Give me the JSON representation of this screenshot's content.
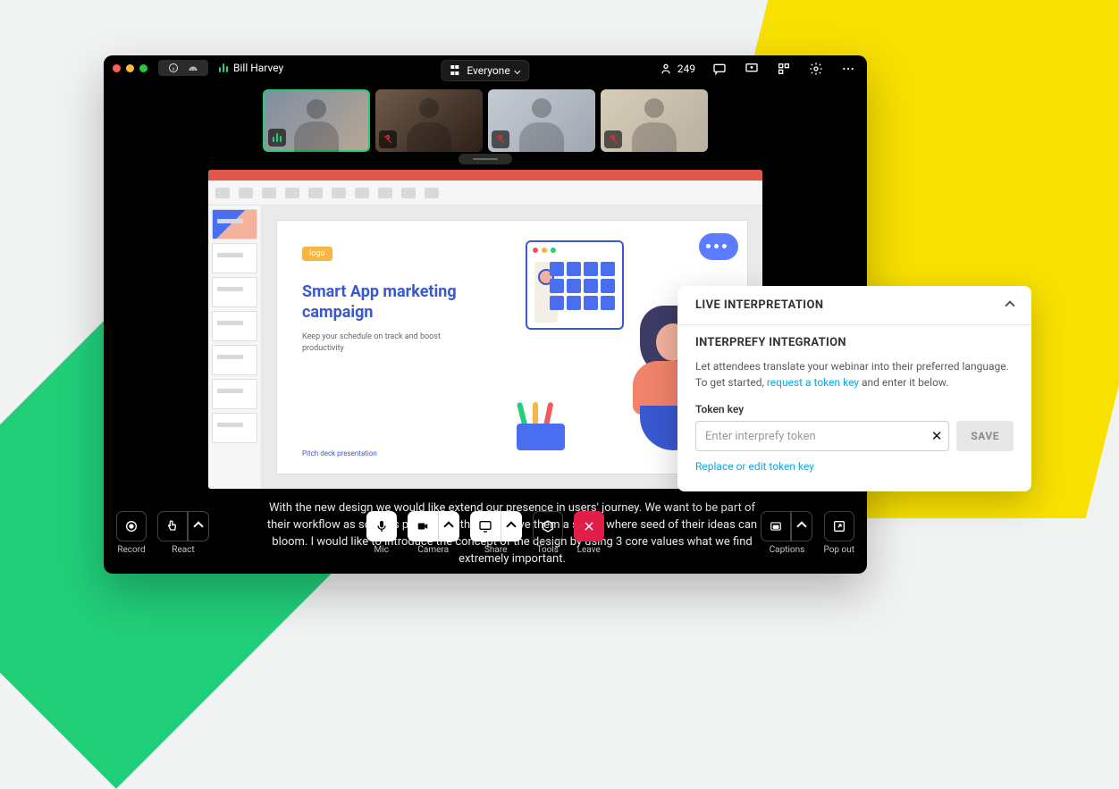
{
  "titlebar": {
    "username": "Bill Harvey"
  },
  "view_switch": {
    "label": "Everyone"
  },
  "participants": {
    "count": "249"
  },
  "slide": {
    "logo": "logo",
    "title": "Smart App marketing campaign",
    "subtitle": "Keep your schedule on track and boost productivity",
    "footer": "Pitch deck presentation"
  },
  "caption_text": "With the new design we would like extend our presence in users' journey. We want to be part of their workflow as soon as possible with that to give them a space where seed of their ideas can bloom. I would like to introduce the concept of the design by using 3 core values what we find extremely important.",
  "controls": {
    "record": "Record",
    "react": "React",
    "mic": "Mic",
    "camera": "Camera",
    "share": "Share",
    "tools": "Tools",
    "leave": "Leave",
    "captions": "Captions",
    "popout": "Pop out"
  },
  "panel": {
    "title": "LIVE INTERPRETATION",
    "section": "INTERPREFY INTEGRATION",
    "desc1": "Let attendees translate your webinar into their preferred language. To get started, ",
    "link": "request a token key",
    "desc2": " and enter it below.",
    "field_label": "Token key",
    "placeholder": "Enter interprefy token",
    "save": "SAVE",
    "edit_link": "Replace or edit token key"
  }
}
